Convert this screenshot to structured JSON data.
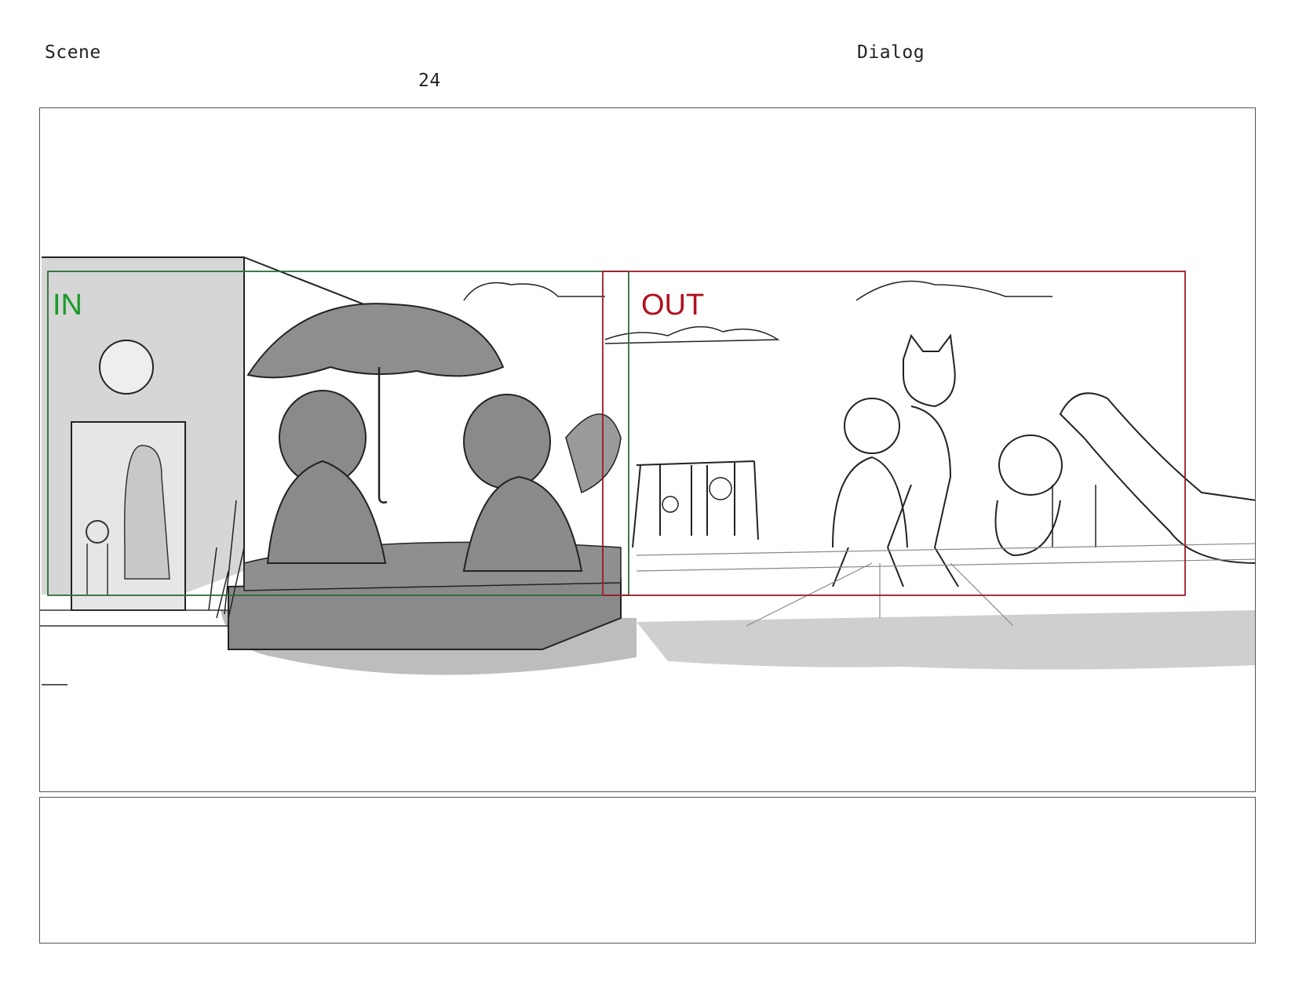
{
  "header": {
    "scene_label": "Scene",
    "scene_number": "24",
    "dialog_label": "Dialog"
  },
  "panel": {
    "in_label": "IN",
    "out_label": "OUT",
    "in_color": "#1a9a2a",
    "out_color": "#b01020",
    "in_frame_color": "#2e6b3a",
    "out_frame_color": "#a0182a"
  },
  "notes": {
    "text": ""
  }
}
